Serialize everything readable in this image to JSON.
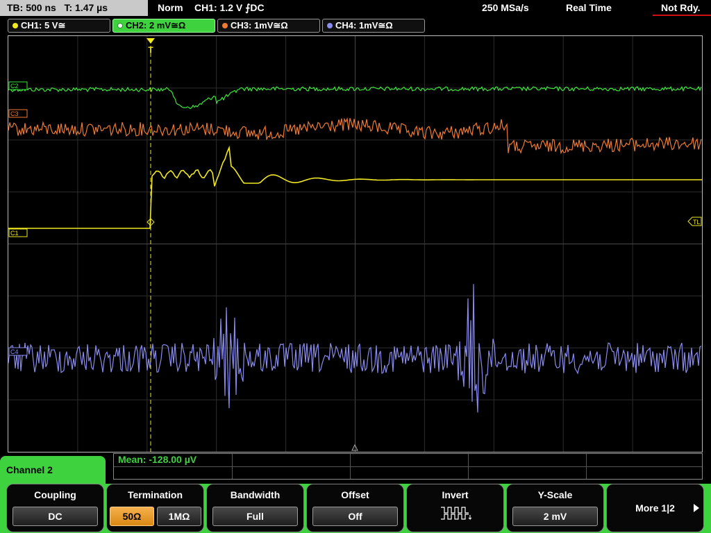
{
  "status_bar": {
    "timebase": "TB: 500 ns",
    "trigger_time": "T: 1.47 µs",
    "trigger_mode": "Norm",
    "trigger_source": "CH1: 1.2 V ⨍DC",
    "sample_rate": "250 MSa/s",
    "acq_mode": "Real Time",
    "acq_state": "Not Rdy.",
    "acq_state_color": "#d01010"
  },
  "channels": [
    {
      "label": "CH1: 5 V≅",
      "color": "#f0e820",
      "active": false
    },
    {
      "label": "CH2: 2 mV≅Ω",
      "color": "#3ce63c",
      "active": true
    },
    {
      "label": "CH3: 1mV≅Ω",
      "color": "#f07a30",
      "active": false
    },
    {
      "label": "CH4: 1mV≅Ω",
      "color": "#8a8cf0",
      "active": false
    }
  ],
  "plot": {
    "trace_labels": [
      "C1",
      "C2",
      "C3",
      "C4"
    ],
    "trigger_level_label": "TL",
    "trigger_marker": "T",
    "grid": true
  },
  "bottom": {
    "menu_title": "Channel 2",
    "mean_label": "Mean: -128.00 µV",
    "accent_color": "#3fd23f",
    "softkeys": [
      {
        "title": "Coupling",
        "value": "DC"
      },
      {
        "title": "Termination",
        "options": [
          "50Ω",
          "1MΩ"
        ],
        "selected": "50Ω"
      },
      {
        "title": "Bandwidth",
        "value": "Full"
      },
      {
        "title": "Offset",
        "value": "Off"
      },
      {
        "title": "Invert",
        "icon": "invert-waveform-icon"
      },
      {
        "title": "Y-Scale",
        "value": "2 mV"
      },
      {
        "more_label": "More 1|2",
        "icon": "play-arrow-icon"
      }
    ]
  }
}
